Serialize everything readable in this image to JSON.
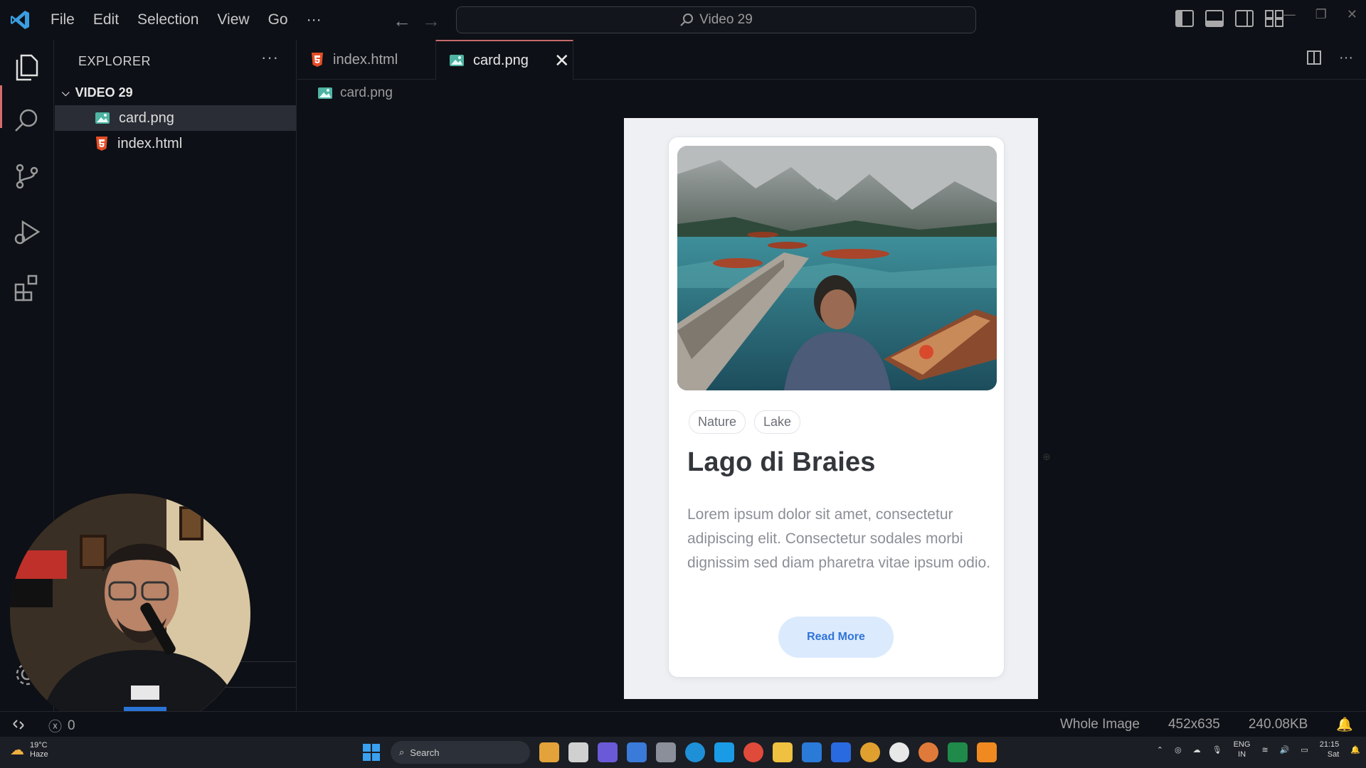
{
  "titlebar": {
    "menu": [
      "File",
      "Edit",
      "Selection",
      "View",
      "Go",
      "···"
    ],
    "search_text": "Video 29"
  },
  "sidebar": {
    "title": "EXPLORER",
    "more": "···",
    "folder": "VIDEO 29",
    "files": [
      {
        "name": "card.png",
        "icon": "image-file-icon"
      },
      {
        "name": "index.html",
        "icon": "html5-icon"
      }
    ]
  },
  "tabs": [
    {
      "label": "index.html",
      "icon": "html5-icon"
    },
    {
      "label": "card.png",
      "icon": "image-file-icon",
      "active": true
    }
  ],
  "tab_close": "✕",
  "breadcrumb": "card.png",
  "card": {
    "tags": [
      "Nature",
      "Lake"
    ],
    "title": "Lago di Braies",
    "body": "Lorem ipsum dolor sit amet, consectetur adipiscing elit. Consectetur sodales morbi dignissim sed diam pharetra vitae ipsum odio.",
    "button": "Read More"
  },
  "statusbar": {
    "problems_count": "0",
    "zoom_mode": "Whole Image",
    "dimensions": "452x635",
    "file_size": "240.08KB"
  },
  "taskbar": {
    "weather_temp": "19°C",
    "weather_desc": "Haze",
    "search_label": "Search",
    "lang_top": "ENG",
    "lang_bottom": "IN",
    "time": "21:15",
    "day": "Sat"
  },
  "colors": {
    "accent_tab": "#c46a6a",
    "card_button_bg": "#dbeafd",
    "card_button_text": "#2f74d8"
  }
}
